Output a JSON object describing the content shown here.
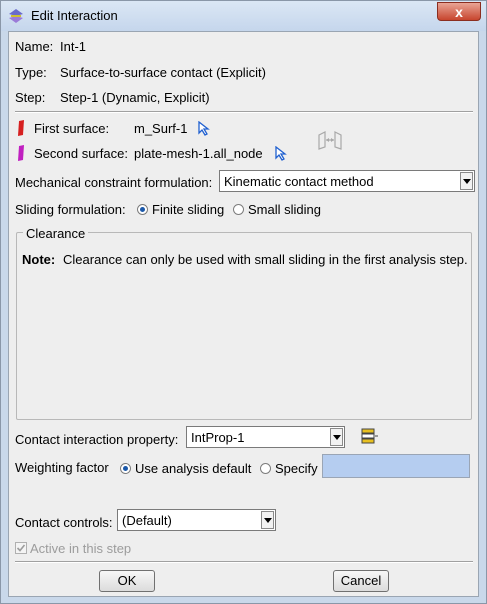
{
  "window": {
    "title": "Edit Interaction",
    "close_glyph": "x"
  },
  "info": {
    "name_label": "Name:",
    "name_value": "Int-1",
    "type_label": "Type:",
    "type_value": "Surface-to-surface contact (Explicit)",
    "step_label": "Step:",
    "step_value": "Step-1 (Dynamic, Explicit)"
  },
  "surfaces": {
    "first_label": "First surface:",
    "first_value": "m_Surf-1",
    "first_color": "#d62020",
    "second_label": "Second surface:",
    "second_value": "plate-mesh-1.all_node",
    "second_color": "#c020c0"
  },
  "mechanical": {
    "label": "Mechanical constraint formulation:",
    "value": "Kinematic contact method"
  },
  "sliding": {
    "label": "Sliding formulation:",
    "option1": "Finite sliding",
    "option2": "Small sliding",
    "selected": "Finite sliding"
  },
  "clearance": {
    "title": "Clearance",
    "note_label": "Note:",
    "note_text": "Clearance can only be used with small sliding in the first analysis step."
  },
  "contact_property": {
    "label": "Contact interaction property:",
    "value": "IntProp-1"
  },
  "weighting": {
    "label": "Weighting factor",
    "option1": "Use analysis default",
    "option2": "Specify",
    "selected": "Use analysis default",
    "specify_value": ""
  },
  "controls": {
    "label": "Contact controls:",
    "value": "(Default)"
  },
  "active": {
    "label": "Active in this step",
    "checked": true
  },
  "buttons": {
    "ok": "OK",
    "cancel": "Cancel"
  }
}
